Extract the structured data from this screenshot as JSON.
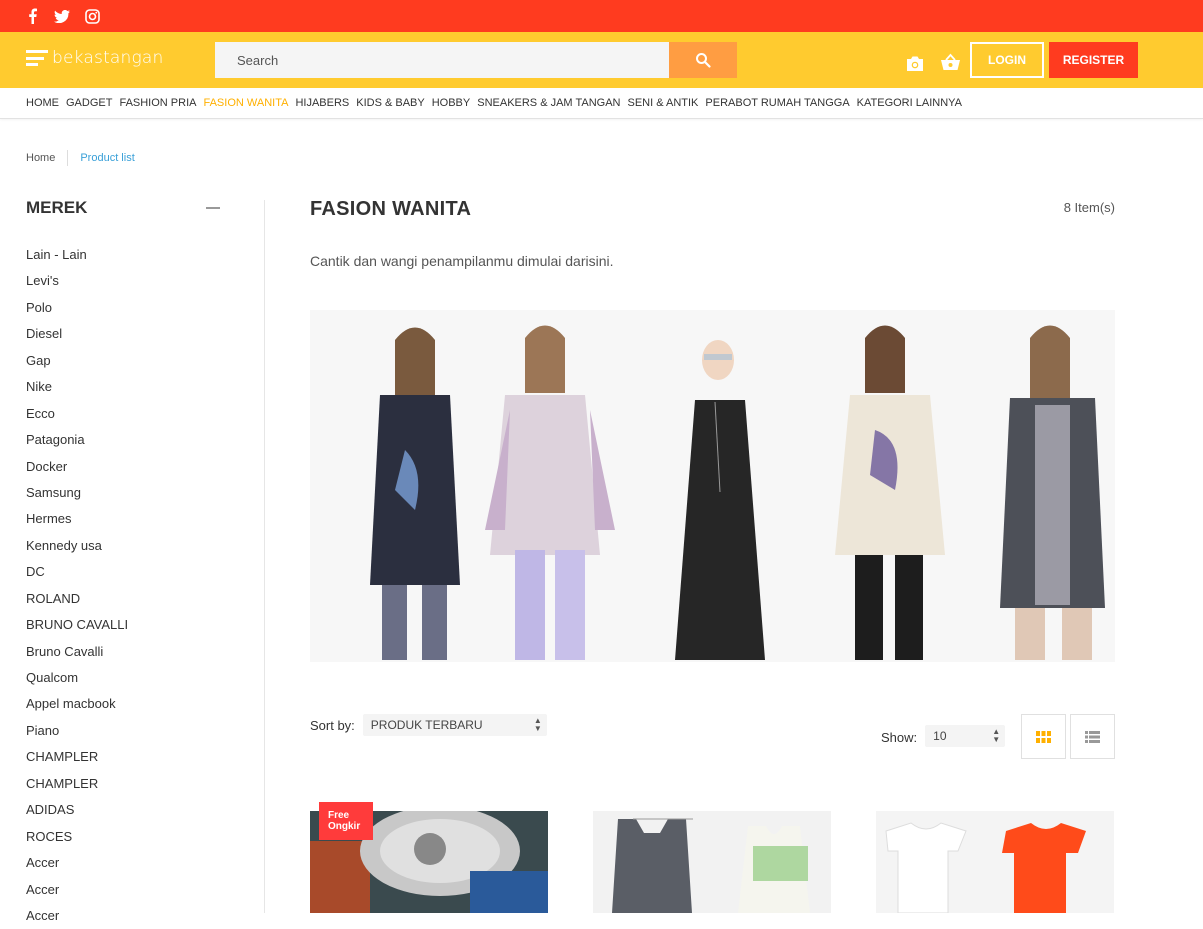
{
  "social": {
    "icons": [
      "facebook-icon",
      "twitter-icon",
      "instagram-icon"
    ]
  },
  "header": {
    "logo_text": "bekastangan",
    "search_placeholder": "Search",
    "login_label": "LOGIN",
    "register_label": "REGISTER"
  },
  "colors": {
    "topbar": "#ff3b1f",
    "header": "#ffcb2f",
    "accent": "#ffb000",
    "search_button": "#ff9d42",
    "link": "#3aa0d8"
  },
  "nav": {
    "items": [
      {
        "label": "HOME"
      },
      {
        "label": "GADGET"
      },
      {
        "label": "FASHION PRIA"
      },
      {
        "label": "FASION WANITA"
      },
      {
        "label": "HIJABERS"
      },
      {
        "label": "KIDS & BABY"
      },
      {
        "label": "HOBBY"
      },
      {
        "label": "SNEAKERS & JAM TANGAN"
      },
      {
        "label": "SENI & ANTIK"
      },
      {
        "label": "PERABOT RUMAH TANGGA"
      },
      {
        "label": "KATEGORI LAINNYA"
      }
    ],
    "active": "FASION WANITA"
  },
  "breadcrumb": {
    "home": "Home",
    "current": "Product list"
  },
  "sidebar": {
    "title": "MEREK",
    "brands": [
      "Lain - Lain",
      "Levi's",
      "Polo",
      "Diesel",
      "Gap",
      "Nike",
      "Ecco",
      "Patagonia",
      "Docker",
      "Samsung",
      "Hermes",
      "Kennedy usa",
      "DC",
      "ROLAND",
      "BRUNO CAVALLI",
      "Bruno Cavalli",
      "Qualcom",
      "Appel macbook",
      "Piano",
      "CHAMPLER",
      "CHAMPLER",
      "ADIDAS",
      "ROCES",
      "Accer",
      "Accer",
      "Accer"
    ]
  },
  "main": {
    "title": "FASION WANITA",
    "count": "8 Item(s)",
    "description": "Cantik dan wangi penampilanmu dimulai darisini."
  },
  "toolbar": {
    "sort_label": "Sort by:",
    "sort_value": "PRODUK TERBARU",
    "show_label": "Show:",
    "show_value": "10"
  },
  "products": {
    "badge_line1": "Free",
    "badge_line2": "Ongkir"
  }
}
